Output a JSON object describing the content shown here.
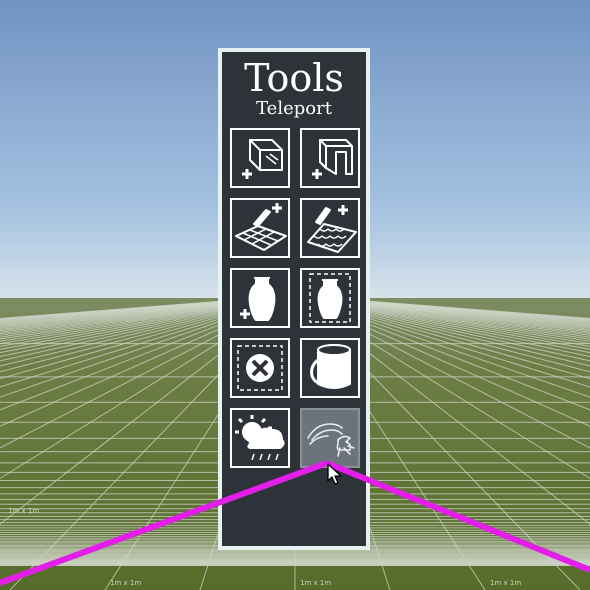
{
  "panel": {
    "title": "Tools",
    "subtitle": "Teleport"
  },
  "tools": [
    {
      "icon": "add-glass-wall-icon",
      "active": false
    },
    {
      "icon": "add-doorway-icon",
      "active": false
    },
    {
      "icon": "add-floor-tiles-icon",
      "active": false
    },
    {
      "icon": "add-roof-tiles-icon",
      "active": false
    },
    {
      "icon": "add-vase-icon",
      "active": false
    },
    {
      "icon": "select-vase-icon",
      "active": false
    },
    {
      "icon": "delete-selection-icon",
      "active": false
    },
    {
      "icon": "paint-bucket-icon",
      "active": false
    },
    {
      "icon": "weather-icon",
      "active": false
    },
    {
      "icon": "teleport-icon",
      "active": true
    }
  ],
  "ground_labels": [
    "1m x 1m",
    "1m x 1m",
    "1m x 1m",
    "1m x 1m"
  ],
  "colors": {
    "panel_bg": "#2d3339",
    "panel_border": "#e6f2ef",
    "pointer_laser": "#e21ee8",
    "active_tool_bg": "#6b737b"
  }
}
